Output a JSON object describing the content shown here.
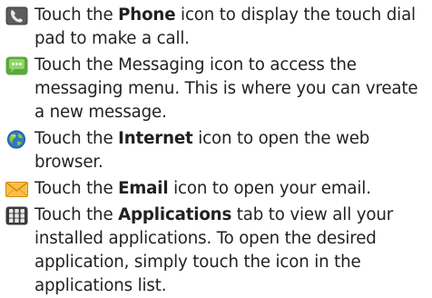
{
  "instructions": [
    {
      "icon": "phone-icon",
      "before": "Touch the ",
      "bold": "Phone",
      "after": " icon to display the touch dial pad to make a call."
    },
    {
      "icon": "messaging-icon",
      "before": "Touch the Messaging icon to access the messaging menu. This is where you can vreate a new message.",
      "bold": "",
      "after": ""
    },
    {
      "icon": "internet-globe-icon",
      "before": "Touch the ",
      "bold": "Internet",
      "after": " icon to open the web browser."
    },
    {
      "icon": "email-envelope-icon",
      "before": "Touch the ",
      "bold": "Email",
      "after": " icon to open your email."
    },
    {
      "icon": "applications-grid-icon",
      "before": "Touch the ",
      "bold": "Applications",
      "after": " tab to view all your installed applications. To open the desired application, simply touch the icon in the applications list."
    }
  ],
  "colors": {
    "text": "#231f20",
    "phone_icon": "#4a4a4a",
    "messaging_icon": "#6cc04a",
    "internet_icon": "#2f78c4",
    "email_icon": "#f3a21b",
    "applications_icon": "#3a3a3a"
  }
}
